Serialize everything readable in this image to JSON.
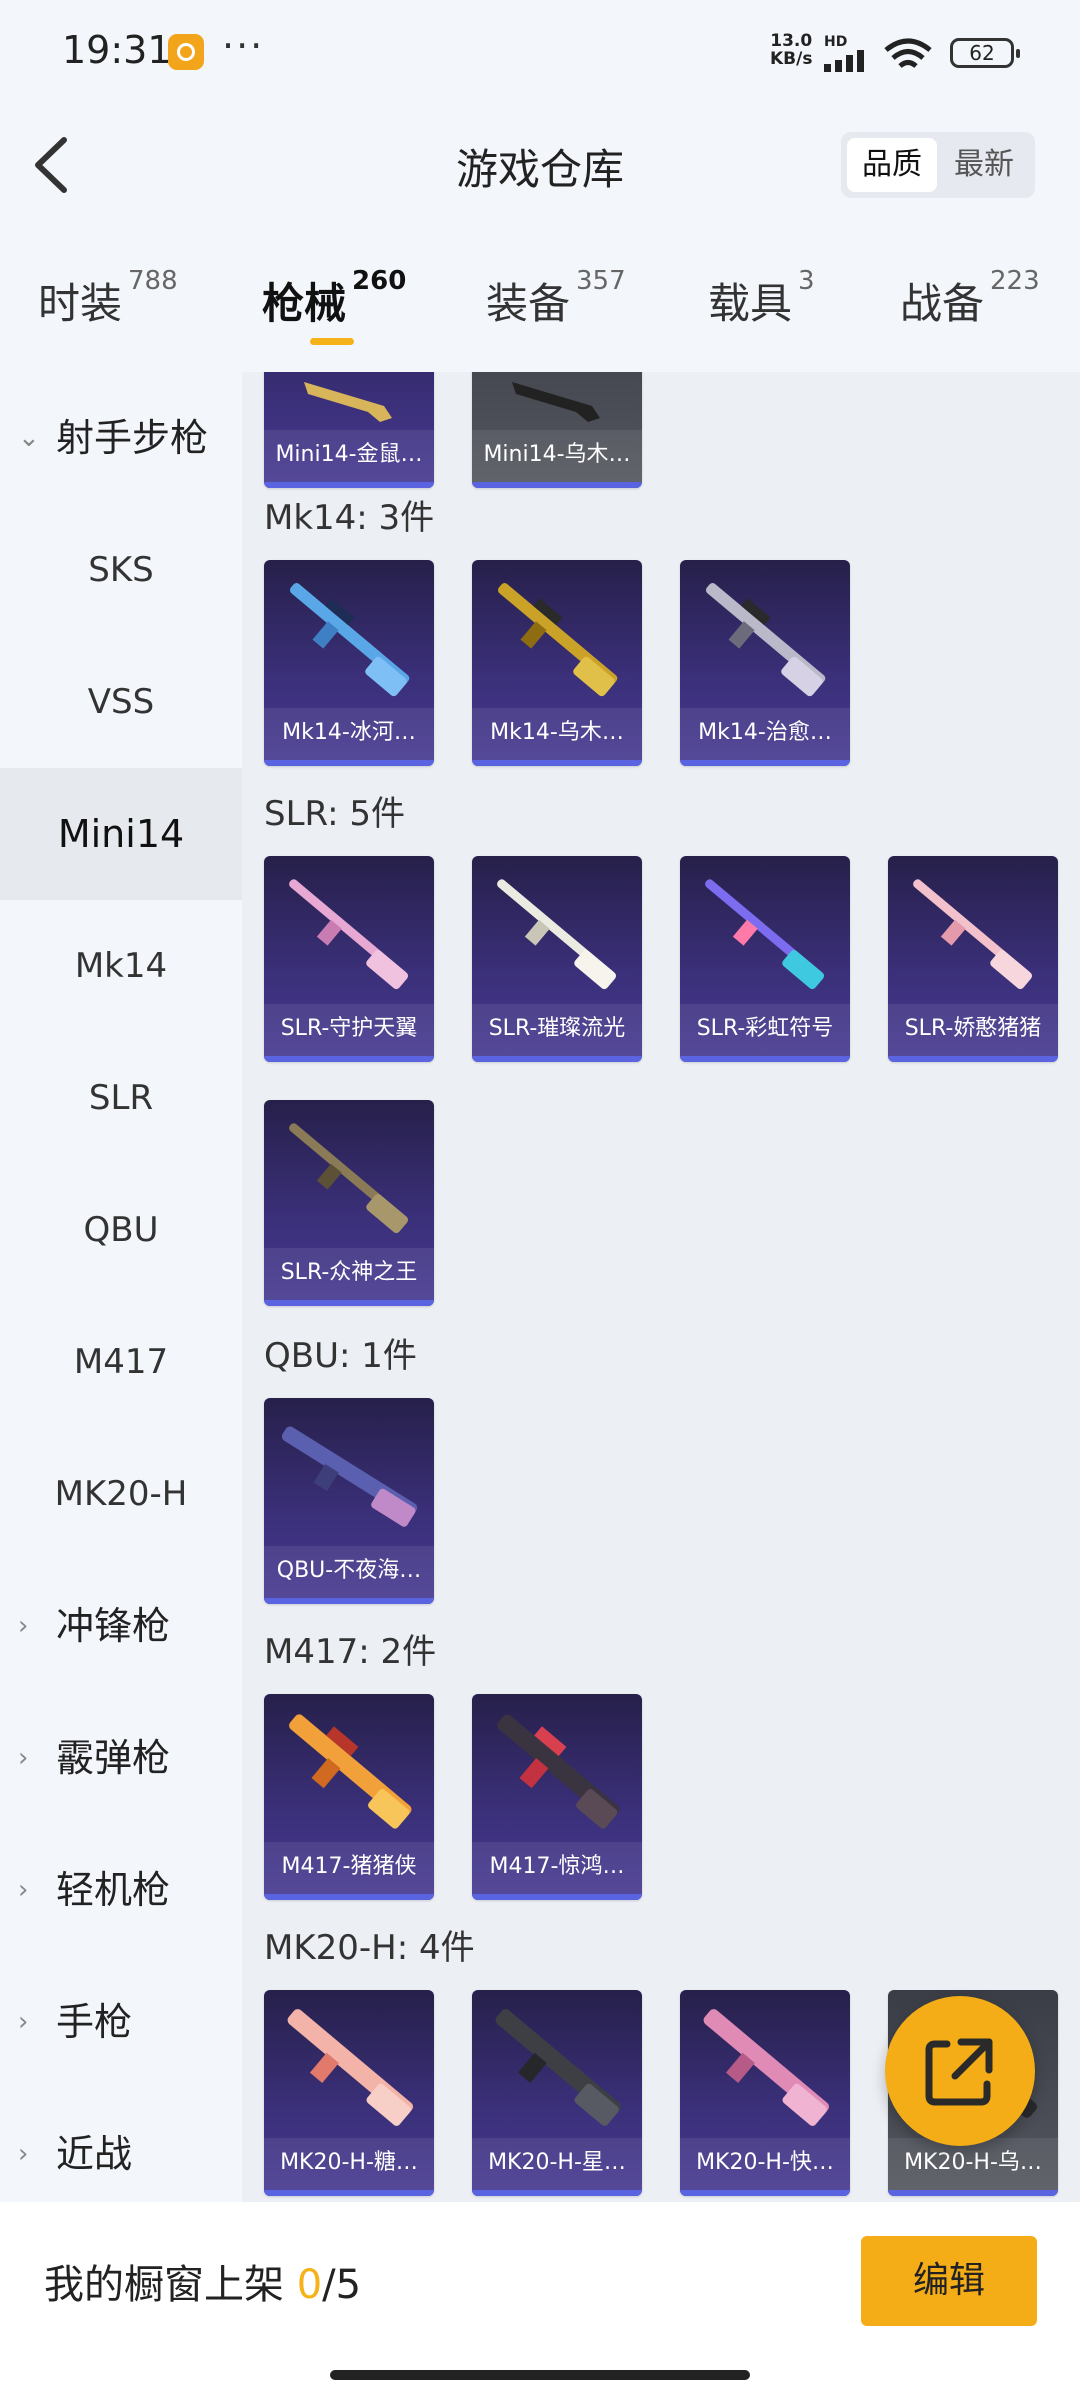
{
  "status_bar": {
    "time": "19:31",
    "dots": "···",
    "net_speed_value": "13.0",
    "net_speed_unit": "KB/s",
    "hd": "HD",
    "battery": "62"
  },
  "header": {
    "title": "游戏仓库",
    "sort_options": [
      "品质",
      "最新"
    ]
  },
  "tabs": [
    {
      "label": "时装",
      "count": "788"
    },
    {
      "label": "枪械",
      "count": "260"
    },
    {
      "label": "装备",
      "count": "357"
    },
    {
      "label": "载具",
      "count": "3"
    },
    {
      "label": "战备",
      "count": "223"
    }
  ],
  "sidebar": {
    "group_main": "射手步枪",
    "items": [
      "SKS",
      "VSS",
      "Mini14",
      "Mk14",
      "SLR",
      "QBU",
      "M417",
      "MK20-H"
    ],
    "groups": [
      "冲锋枪",
      "霰弹枪",
      "轻机枪",
      "手枪",
      "近战"
    ]
  },
  "sections": [
    {
      "label": "",
      "items": [
        "Mini14-金鼠…",
        "Mini14-乌木…"
      ]
    },
    {
      "label": "Mk14: 3件",
      "items": [
        "Mk14-冰河…",
        "Mk14-乌木…",
        "Mk14-治愈…"
      ]
    },
    {
      "label": "SLR: 5件",
      "items": [
        "SLR-守护天翼",
        "SLR-璀璨流光",
        "SLR-彩虹符号",
        "SLR-娇憨猪猪",
        "SLR-众神之王"
      ]
    },
    {
      "label": "QBU: 1件",
      "items": [
        "QBU-不夜海…"
      ]
    },
    {
      "label": "M417: 2件",
      "items": [
        "M417-猪猪侠",
        "M417-惊鸿…"
      ]
    },
    {
      "label": "MK20-H: 4件",
      "items": [
        "MK20-H-糖…",
        "MK20-H-星…",
        "MK20-H-快…",
        "MK20-H-乌…"
      ]
    }
  ],
  "bottom": {
    "shelf_label": "我的橱窗上架",
    "shelf_current": "0",
    "shelf_total": "/5",
    "edit_label": "编辑"
  },
  "colors": {
    "accent": "#f5b21a",
    "card_bottom_line": "#5a63e0"
  }
}
